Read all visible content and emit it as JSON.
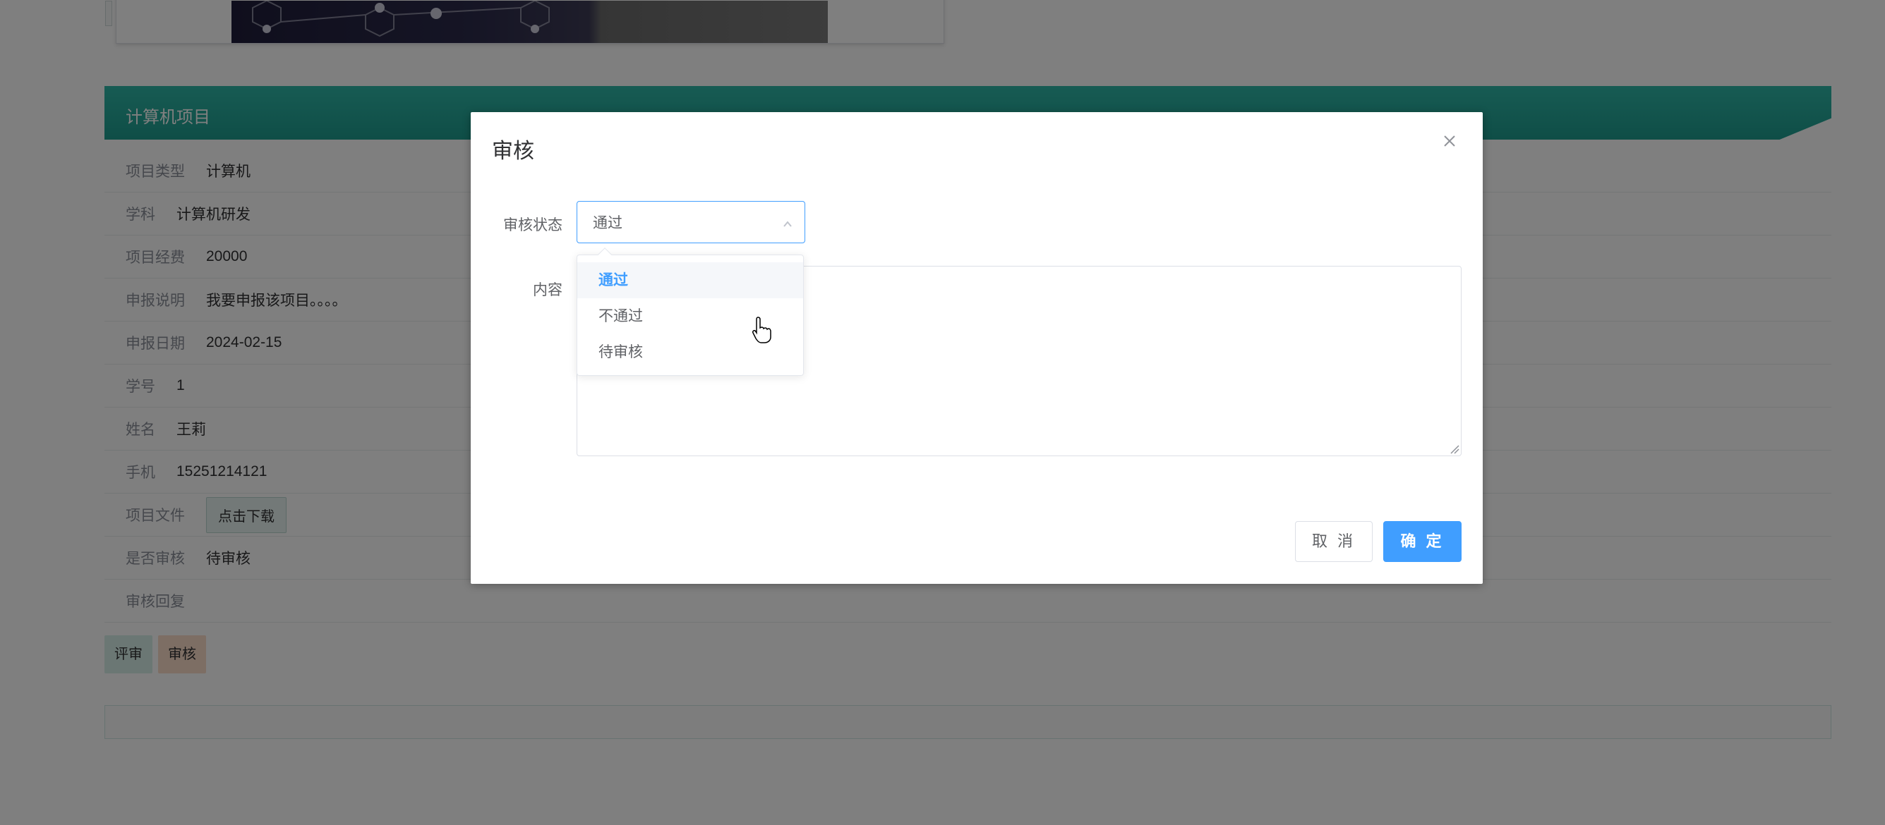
{
  "section": {
    "title": "计算机项目",
    "download_button": "点击下载"
  },
  "info_rows": [
    {
      "label": "项目类型",
      "value": "计算机"
    },
    {
      "label": "学科",
      "value": "计算机研发"
    },
    {
      "label": "项目经费",
      "value": "20000"
    },
    {
      "label": "申报说明",
      "value": "我要申报该项目。。。。"
    },
    {
      "label": "申报日期",
      "value": "2024-02-15"
    },
    {
      "label": "学号",
      "value": "1"
    },
    {
      "label": "姓名",
      "value": "王莉"
    },
    {
      "label": "手机",
      "value": "15251214121"
    },
    {
      "label": "项目文件",
      "value": ""
    },
    {
      "label": "是否审核",
      "value": "待审核"
    },
    {
      "label": "审核回复",
      "value": ""
    }
  ],
  "actions": {
    "review_label": "评审",
    "audit_label": "审核"
  },
  "dialog": {
    "title": "审核",
    "status_label": "审核状态",
    "status_value": "通过",
    "status_options": [
      "通过",
      "不通过",
      "待审核"
    ],
    "content_label": "内容",
    "content_value": "",
    "cancel_label": "取 消",
    "confirm_label": "确 定"
  },
  "colors": {
    "accent": "#409eff",
    "header_teal": "#1e9c8e"
  },
  "icons": {
    "close": "close-icon",
    "arrow": "chevron-up-icon",
    "cursor": "hand-pointer-icon"
  }
}
